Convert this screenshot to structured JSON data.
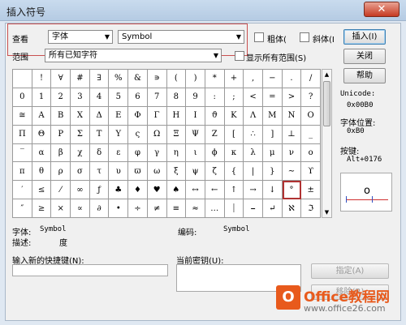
{
  "window": {
    "title": "插入符号",
    "close_glyph": "✕"
  },
  "view": {
    "label": "查看",
    "font_value": "字体",
    "charset_value": "Symbol",
    "bold_label": "粗体(",
    "italic_label": "斜体(I",
    "range_label": "范围",
    "range_value": "所有已知字符",
    "show_all_ranges_label": "显示所有范围(S)"
  },
  "buttons": {
    "insert": "插入(I)",
    "close": "关闭",
    "help": "帮助",
    "assign": "指定(A)",
    "remove": "移除(R)"
  },
  "grid": {
    "selected_index": 110,
    "cells": [
      " ",
      "!",
      "∀",
      "#",
      "∃",
      "%",
      "&",
      "∍",
      "(",
      ")",
      "*",
      "+",
      ",",
      "−",
      ".",
      "/",
      "0",
      "1",
      "2",
      "3",
      "4",
      "5",
      "6",
      "7",
      "8",
      "9",
      ":",
      ";",
      "<",
      "=",
      ">",
      "?",
      "≅",
      "Α",
      "Β",
      "Χ",
      "Δ",
      "Ε",
      "Φ",
      "Γ",
      "Η",
      "Ι",
      "ϑ",
      "Κ",
      "Λ",
      "Μ",
      "Ν",
      "Ο",
      "Π",
      "Θ",
      "Ρ",
      "Σ",
      "Τ",
      "Υ",
      "ς",
      "Ω",
      "Ξ",
      "Ψ",
      "Ζ",
      "[",
      "∴",
      "]",
      "⊥",
      "_",
      "‾",
      "α",
      "β",
      "χ",
      "δ",
      "ε",
      "φ",
      "γ",
      "η",
      "ι",
      "ϕ",
      "κ",
      "λ",
      "μ",
      "ν",
      "ο",
      "π",
      "θ",
      "ρ",
      "σ",
      "τ",
      "υ",
      "ϖ",
      "ω",
      "ξ",
      "ψ",
      "ζ",
      "{",
      "|",
      "}",
      "∼",
      "ϒ",
      "′",
      "≤",
      "⁄",
      "∞",
      "ƒ",
      "♣",
      "♦",
      "♥",
      "♠",
      "↔",
      "←",
      "↑",
      "→",
      "↓",
      "°",
      "±",
      "″",
      "≥",
      "×",
      "∝",
      "∂",
      "•",
      "÷",
      "≠",
      "≡",
      "≈",
      "…",
      "⏐",
      "⎯",
      "↵",
      "ℵ",
      "ℑ"
    ]
  },
  "info": {
    "unicode_label": "Unicode:",
    "unicode_value": "0x00B0",
    "font_pos_label": "字体位置:",
    "font_pos_value": "0xB0",
    "key_label": "按键:",
    "key_value": "Alt+0176",
    "preview_char": "o"
  },
  "details": {
    "font_label": "字体:",
    "font_value": "Symbol",
    "desc_label": "描述:",
    "desc_value": "度",
    "encoding_label": "编码:",
    "encoding_value": "Symbol"
  },
  "shortcut": {
    "new_label": "输入新的快捷键(N):",
    "current_label": "当前密钥(U):"
  },
  "watermark": {
    "logo_text": "O",
    "title": "Office教程网",
    "url": "www.office26.com"
  }
}
